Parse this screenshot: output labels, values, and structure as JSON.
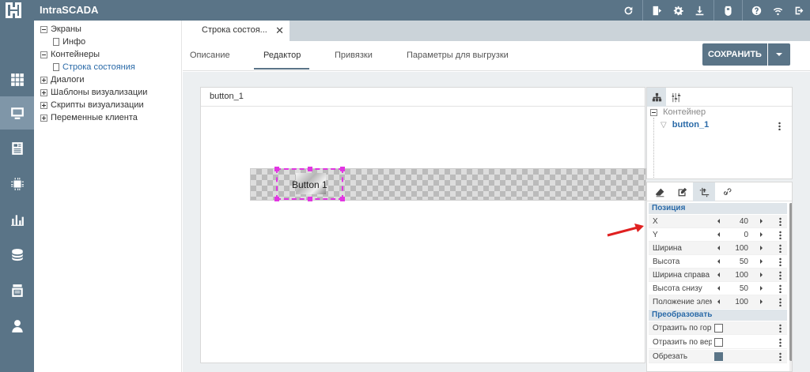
{
  "app": {
    "title": "IntraSCADA"
  },
  "tree": {
    "items": [
      {
        "label": "Экраны",
        "kind": "minus",
        "indent": 0
      },
      {
        "label": "Инфо",
        "kind": "doc",
        "indent": 1
      },
      {
        "label": "Контейнеры",
        "kind": "minus",
        "indent": 0
      },
      {
        "label": "Строка состояния",
        "kind": "doc",
        "indent": 1,
        "selected": true
      },
      {
        "label": "Диалоги",
        "kind": "plus",
        "indent": 0
      },
      {
        "label": "Шаблоны визуализации",
        "kind": "plus",
        "indent": 0
      },
      {
        "label": "Скрипты визуализации",
        "kind": "plus",
        "indent": 0
      },
      {
        "label": "Переменные клиента",
        "kind": "plus",
        "indent": 0
      }
    ]
  },
  "doc_tab": {
    "label": "Строка состоя...",
    "close": "✕"
  },
  "subtabs": [
    {
      "label": "Описание",
      "active": false
    },
    {
      "label": "Редактор",
      "active": true
    },
    {
      "label": "Привязки",
      "active": false
    },
    {
      "label": "Параметры для выгрузки",
      "active": false
    }
  ],
  "toolbar": {
    "save_label": "СОХРАНИТЬ"
  },
  "canvas": {
    "title": "button_1",
    "button_label": "Button 1"
  },
  "element_tree": {
    "root_label": "Контейнер",
    "child_label": "button_1"
  },
  "properties": {
    "position_section": "Позиция",
    "transform_section": "Преобразовать",
    "position_rows": [
      {
        "label": "X",
        "value": "40"
      },
      {
        "label": "Y",
        "value": "0"
      },
      {
        "label": "Ширина",
        "value": "100"
      },
      {
        "label": "Высота",
        "value": "50"
      },
      {
        "label": "Ширина справа",
        "value": "100"
      },
      {
        "label": "Высота снизу",
        "value": "50"
      },
      {
        "label": "Положение элем",
        "value": "100"
      }
    ],
    "transform_rows": [
      {
        "label": "Отразить по гор",
        "checked": false
      },
      {
        "label": "Отразить по вер",
        "checked": false
      },
      {
        "label": "Обрезать",
        "checked": true
      }
    ]
  },
  "colors": {
    "accent": "#5a7487",
    "selection": "#e236e2",
    "annotation_arrow": "#e02020",
    "link": "#2a6aa8"
  }
}
